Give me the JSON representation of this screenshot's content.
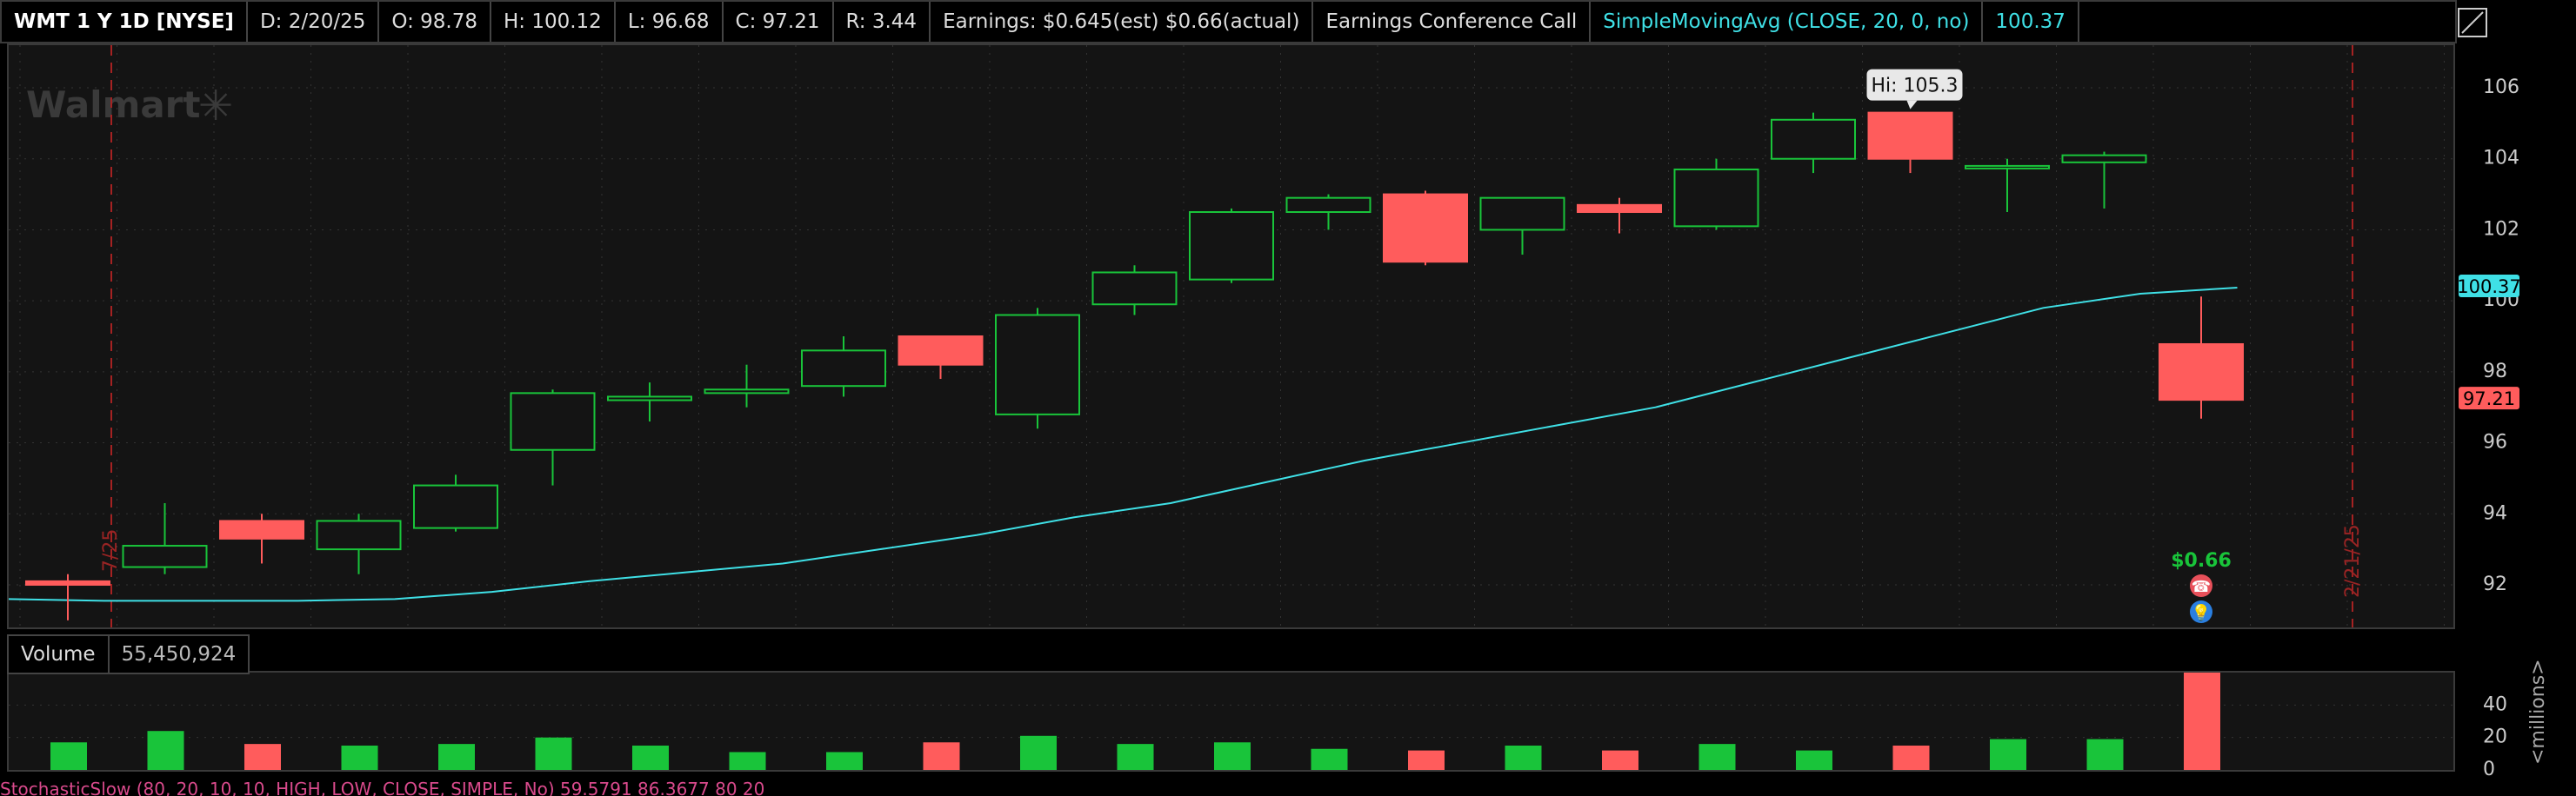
{
  "header": {
    "symbol": "WMT 1 Y 1D [NYSE]",
    "date": "D: 2/20/25",
    "open": "O: 98.78",
    "high": "H: 100.12",
    "low": "L: 96.68",
    "close": "C: 97.21",
    "range": "R: 3.44",
    "earnings": "Earnings: $0.645(est) $0.66(actual)",
    "conference": "Earnings Conference Call",
    "sma_label": "SimpleMovingAvg (CLOSE, 20, 0, no)",
    "sma_value": "100.37"
  },
  "watermark": "Walmart",
  "price_axis": {
    "ticks": [
      "106",
      "104",
      "102",
      "100",
      "98",
      "96",
      "94",
      "92"
    ]
  },
  "markers": {
    "hi_tooltip": "Hi: 105.3",
    "sma_tag": "100.37",
    "close_tag": "97.21",
    "date_left": "7/25",
    "date_right": "2/21/25",
    "earnings_amount": "$0.66"
  },
  "volume": {
    "label": "Volume",
    "value": "55,450,924",
    "unit": "<millions>",
    "ticks": [
      "40",
      "20",
      "0"
    ]
  },
  "footer": {
    "stochastic": "StochasticSlow (80, 20, 10, 10, HIGH, LOW, CLOSE, SIMPLE, No) 59.5791 86.3677 80 20"
  },
  "colors": {
    "up": "#19c43a",
    "down": "#ff5c5c",
    "sma": "#3fe0e6",
    "background": "#141414"
  },
  "chart_data": {
    "type": "candlestick",
    "y_range": [
      90.8,
      107.2
    ],
    "sma_label": "SimpleMovingAvg (CLOSE, 20, 0, no)",
    "candles": [
      {
        "o": 92.1,
        "h": 92.3,
        "l": 91.0,
        "c": 92.0
      },
      {
        "o": 92.5,
        "h": 94.3,
        "l": 92.3,
        "c": 93.1
      },
      {
        "o": 93.8,
        "h": 94.0,
        "l": 92.6,
        "c": 93.3
      },
      {
        "o": 93.0,
        "h": 94.0,
        "l": 92.3,
        "c": 93.8
      },
      {
        "o": 93.6,
        "h": 95.1,
        "l": 93.5,
        "c": 94.8
      },
      {
        "o": 95.8,
        "h": 97.5,
        "l": 94.8,
        "c": 97.4
      },
      {
        "o": 97.2,
        "h": 97.7,
        "l": 96.6,
        "c": 97.3
      },
      {
        "o": 97.4,
        "h": 98.2,
        "l": 97.0,
        "c": 97.5
      },
      {
        "o": 97.6,
        "h": 99.0,
        "l": 97.3,
        "c": 98.6
      },
      {
        "o": 99.0,
        "h": 99.0,
        "l": 97.8,
        "c": 98.2
      },
      {
        "o": 96.8,
        "h": 99.8,
        "l": 96.4,
        "c": 99.6
      },
      {
        "o": 99.9,
        "h": 101.0,
        "l": 99.6,
        "c": 100.8
      },
      {
        "o": 100.6,
        "h": 102.6,
        "l": 100.5,
        "c": 102.5
      },
      {
        "o": 102.5,
        "h": 103.0,
        "l": 102.0,
        "c": 102.9
      },
      {
        "o": 103.0,
        "h": 103.1,
        "l": 101.0,
        "c": 101.1
      },
      {
        "o": 102.0,
        "h": 102.9,
        "l": 101.3,
        "c": 102.9
      },
      {
        "o": 102.7,
        "h": 102.9,
        "l": 101.9,
        "c": 102.5
      },
      {
        "o": 102.1,
        "h": 104.0,
        "l": 102.0,
        "c": 103.7
      },
      {
        "o": 104.0,
        "h": 105.3,
        "l": 103.6,
        "c": 105.1
      },
      {
        "o": 105.3,
        "h": 105.3,
        "l": 103.6,
        "c": 104.0
      },
      {
        "o": 103.8,
        "h": 104.0,
        "l": 102.5,
        "c": 103.8
      },
      {
        "o": 103.9,
        "h": 104.2,
        "l": 102.6,
        "c": 104.1
      },
      {
        "o": 98.78,
        "h": 100.12,
        "l": 96.68,
        "c": 97.21
      }
    ],
    "sma": [
      91.6,
      91.55,
      91.55,
      91.55,
      91.6,
      91.8,
      92.1,
      92.35,
      92.6,
      93.0,
      93.4,
      93.9,
      94.3,
      94.9,
      95.5,
      96.0,
      96.5,
      97.0,
      97.7,
      98.4,
      99.1,
      99.8,
      100.2,
      100.37
    ],
    "volume_millions": [
      17,
      24,
      16,
      15,
      16,
      20,
      15,
      11,
      11,
      17,
      21,
      16,
      17,
      13,
      12,
      15,
      12,
      16,
      12,
      15,
      19,
      19,
      62
    ],
    "volume_up": [
      true,
      true,
      false,
      true,
      true,
      true,
      true,
      true,
      true,
      false,
      true,
      true,
      true,
      true,
      false,
      true,
      false,
      true,
      true,
      false,
      true,
      true,
      false
    ],
    "volume_range": [
      0,
      60
    ]
  }
}
